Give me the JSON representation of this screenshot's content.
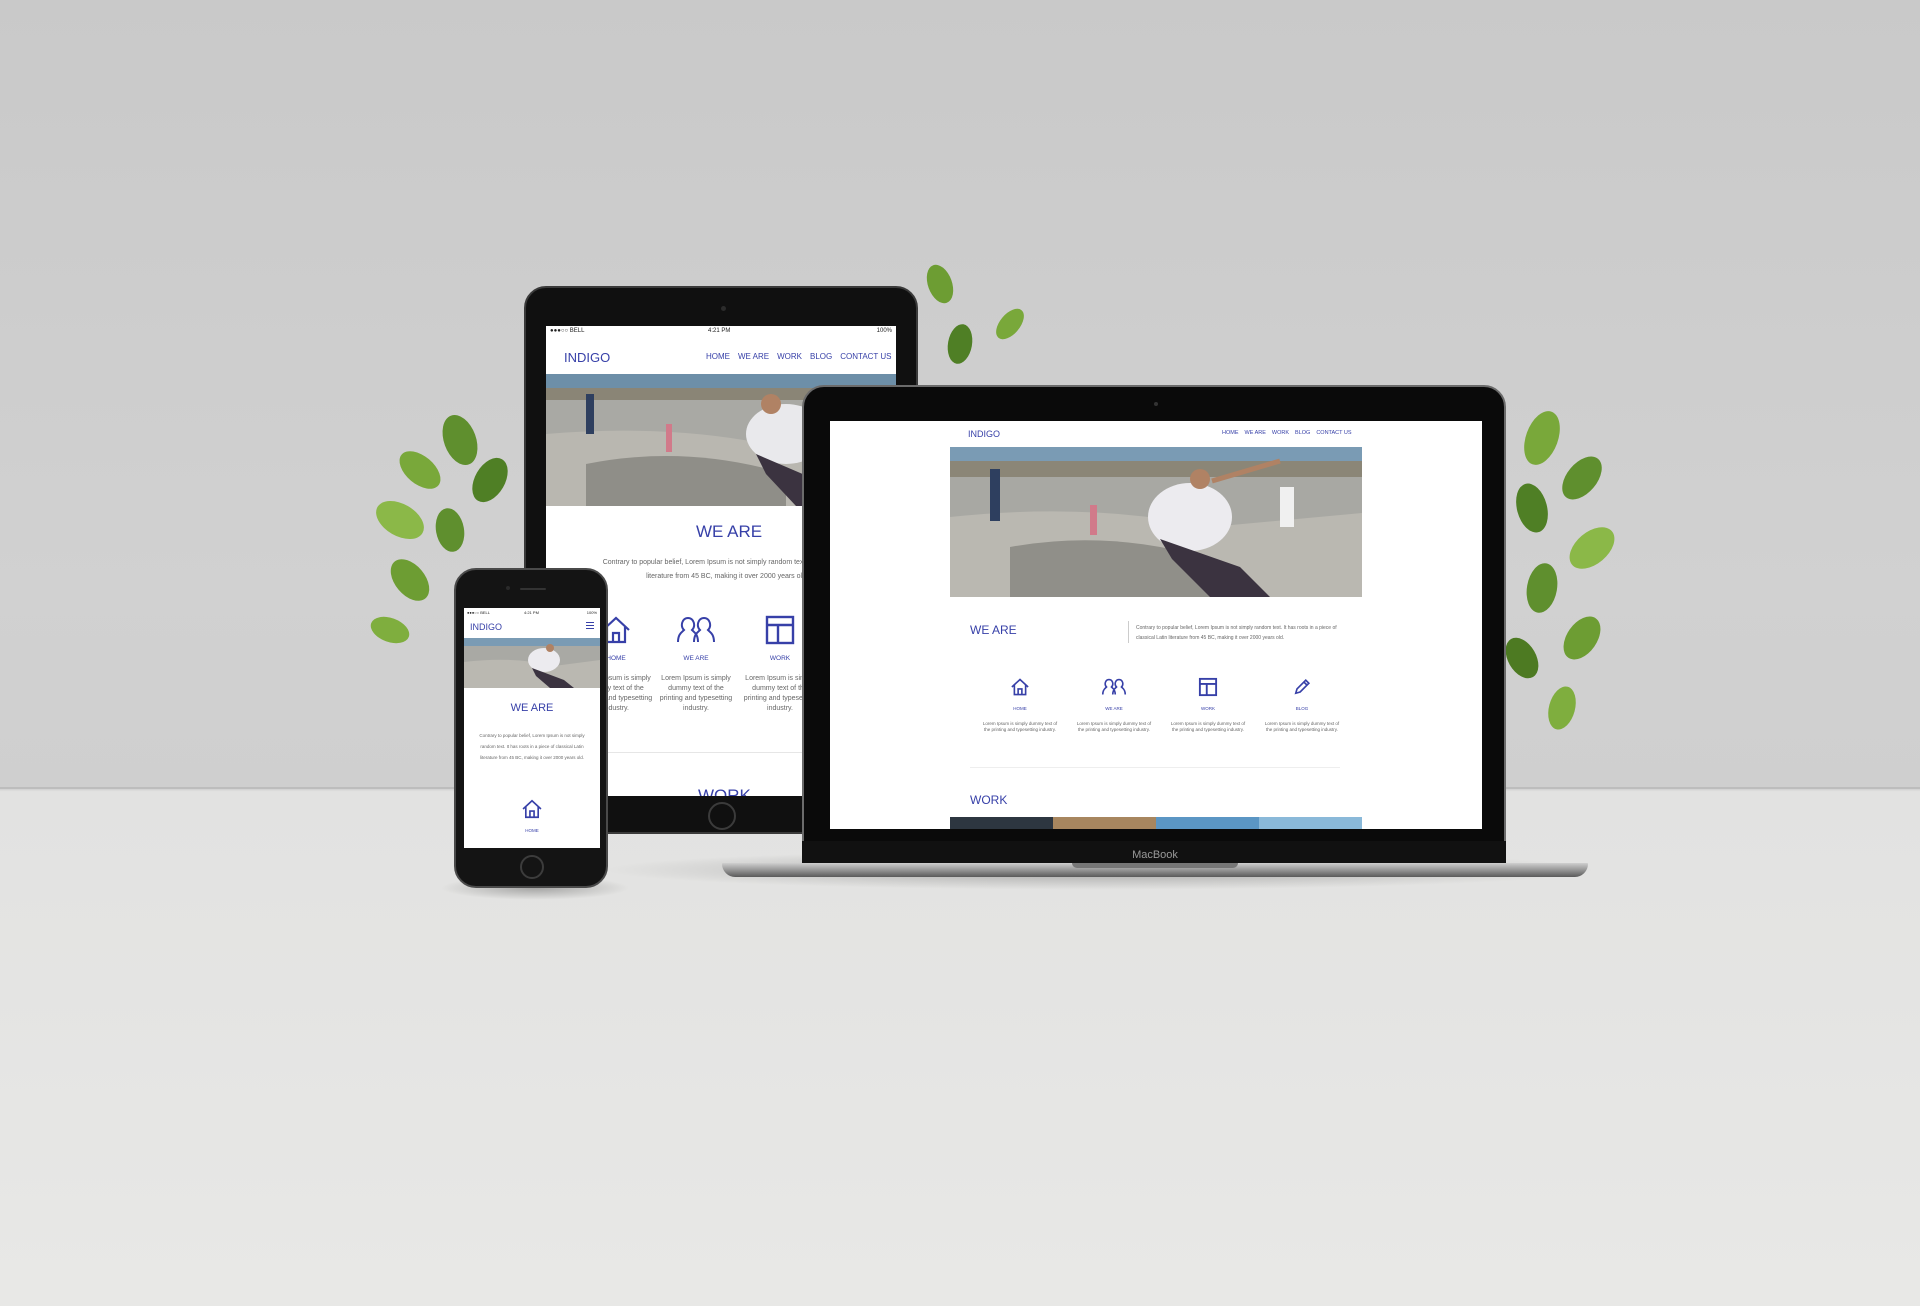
{
  "colors": {
    "accent": "#3740a8",
    "body_text": "#666666",
    "background": "#cccccc"
  },
  "tablet": {
    "status": {
      "carrier": "●●●○○ BELL",
      "time": "4:21 PM",
      "battery": "100%"
    },
    "logo": "INDIGO",
    "nav": [
      "HOME",
      "WE ARE",
      "WORK",
      "BLOG",
      "CONTACT US"
    ],
    "section_title": "WE ARE",
    "intro_line1": "Contrary to popular belief, Lorem Ipsum is not simply random text. It has roots in",
    "intro_line2": "literature from 45 BC, making it over 2000 years old.",
    "features": [
      {
        "icon": "home-icon",
        "label": "HOME",
        "text": "Lorem Ipsum is simply dummy text of the printing and typesetting industry."
      },
      {
        "icon": "people-icon",
        "label": "WE ARE",
        "text": "Lorem Ipsum is simply dummy text of the printing and typesetting industry."
      },
      {
        "icon": "layout-icon",
        "label": "WORK",
        "text": "Lorem Ipsum is simply dummy text of the printing and typesetting industry."
      }
    ],
    "next_section": "WORK"
  },
  "laptop": {
    "brand": "MacBook",
    "logo": "INDIGO",
    "nav": [
      "HOME",
      "WE ARE",
      "WORK",
      "BLOG",
      "CONTACT US"
    ],
    "section_title": "WE ARE",
    "intro_line1": "Contrary to popular belief, Lorem Ipsum is not simply random text. It has roots in a piece of",
    "intro_line2": "classical Latin literature from 45 BC, making it over 2000 years old.",
    "features": [
      {
        "icon": "home-icon",
        "label": "HOME",
        "text": "Lorem Ipsum is simply dummy text of the printing and typesetting industry."
      },
      {
        "icon": "people-icon",
        "label": "WE ARE",
        "text": "Lorem Ipsum is simply dummy text of the printing and typesetting industry."
      },
      {
        "icon": "layout-icon",
        "label": "WORK",
        "text": "Lorem Ipsum is simply dummy text of the printing and typesetting industry."
      },
      {
        "icon": "pencil-icon",
        "label": "BLOG",
        "text": "Lorem Ipsum is simply dummy text of the printing and typesetting industry."
      }
    ],
    "next_section": "WORK"
  },
  "phone": {
    "status": {
      "carrier": "●●●○○ BELL",
      "time": "4:21 PM",
      "battery": "100%"
    },
    "logo": "INDIGO",
    "menu_icon": "hamburger-icon",
    "section_title": "WE ARE",
    "intro_line1": "Contrary to popular belief, Lorem Ipsum is not simply",
    "intro_line2": "random text. It has roots in a piece of classical Latin",
    "intro_line3": "literature from 45 BC, making it over 2000 years old.",
    "feature": {
      "icon": "home-icon",
      "label": "HOME"
    }
  }
}
